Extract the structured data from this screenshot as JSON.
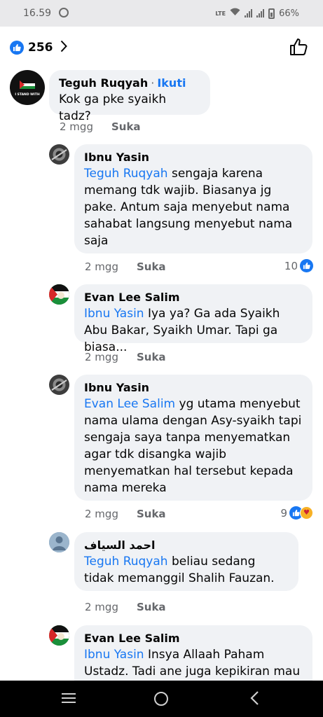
{
  "status_bar": {
    "time": "16.59",
    "battery": "66%",
    "network": "LTE"
  },
  "header": {
    "like_count": "256"
  },
  "comments": [
    {
      "author": "Teguh Ruqyah",
      "follow": "Ikuti",
      "mention": "",
      "text": "Kok ga pke syaikh tadz?",
      "time": "2 mgg",
      "like_label": "Suka",
      "reactions": ""
    },
    {
      "author": "Ibnu Yasin",
      "mention": "Teguh Ruqyah",
      "text": "sengaja karena memang tdk wajib. Biasanya jg pake. Antum saja menyebut nama sahabat langsung menyebut nama saja",
      "time": "2 mgg",
      "like_label": "Suka",
      "reactions": "10"
    },
    {
      "author": "Evan Lee Salim",
      "mention": "Ibnu Yasin",
      "text": "Iya ya? Ga ada Syaikh Abu Bakar, Syaikh Umar. Tapi ga biasa...",
      "time": "2 mgg",
      "like_label": "Suka",
      "reactions": ""
    },
    {
      "author": "Ibnu Yasin",
      "mention": "Evan Lee Salim",
      "text": "yg utama menyebut nama ulama dengan Asy-syaikh tapi sengaja saya tanpa menyematkan agar tdk disangka wajib menyematkan hal tersebut kepada nama mereka",
      "time": "2 mgg",
      "like_label": "Suka",
      "reactions": "9"
    },
    {
      "author": "احمد السياف",
      "mention": "Teguh Ruqyah",
      "text": "beliau sedang tidak memanggil Shalih Fauzan.",
      "time": "2 mgg",
      "like_label": "Suka",
      "reactions": ""
    },
    {
      "author": "Evan Lee Salim",
      "mention": "Ibnu Yasin",
      "text": "Insya Allaah Paham Ustadz. Tadi ane juga kepikiran mau",
      "time": "",
      "like_label": "",
      "reactions": ""
    }
  ],
  "avatar_labels": {
    "teguh": "I STAND WITH"
  },
  "colors": {
    "accent": "#1877f2",
    "bubble": "#f0f2f5",
    "secondary_text": "#65676b"
  }
}
